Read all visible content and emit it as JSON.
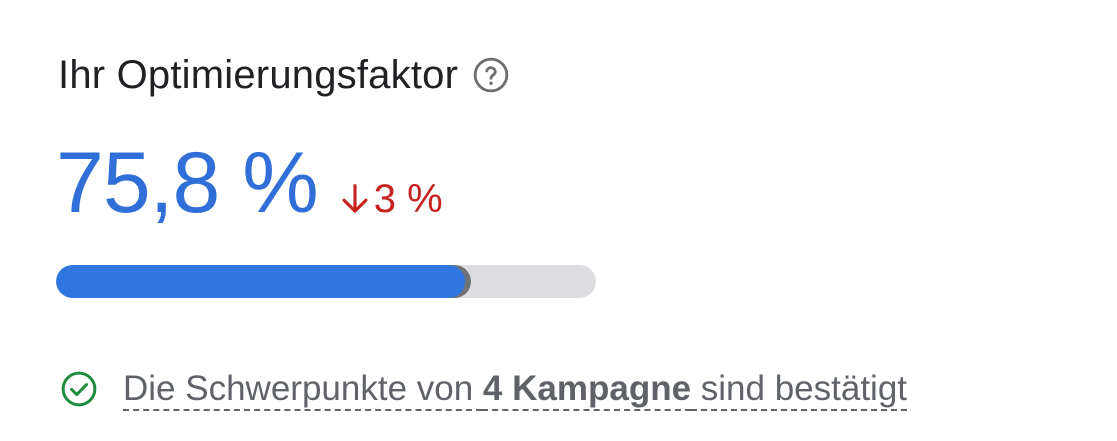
{
  "header": {
    "title": "Ihr Optimierungsfaktor",
    "help_icon": "help-circle-icon"
  },
  "score": {
    "value": "75,8 %",
    "progress_fraction": 0.758,
    "delta_icon": "arrow-down-icon",
    "delta_value": "3 %",
    "delta_direction": "down"
  },
  "status": {
    "icon": "check-circle-icon",
    "text_before": "Die Schwerpunkte von ",
    "text_bold": "4 Kampagne",
    "text_after": " sind bestätigt"
  },
  "colors": {
    "score": "#2f6fd7",
    "progress_fill": "#2f76e0",
    "progress_track": "#dddde1",
    "delta": "#c5221f",
    "check": "#1e8e3e"
  }
}
